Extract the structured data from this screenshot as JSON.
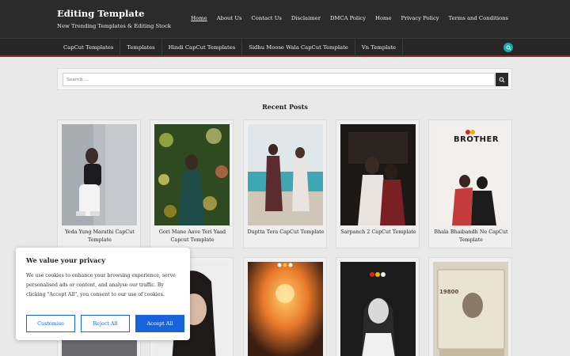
{
  "site": {
    "title": "Editing Template",
    "description": "New Trending Templates & Editing Stock"
  },
  "top_nav": [
    "Home",
    "About Us",
    "Contact Us",
    "Disclaimer",
    "DMCA Policy",
    "Home",
    "Privacy Policy",
    "Terms and Conditions"
  ],
  "secondary_nav": [
    "CapCut Templates",
    "Templates",
    "Hindi CapCut Templates",
    "Sidhu Moose Wala CapCut Template",
    "Vn Template"
  ],
  "search": {
    "placeholder": "Search ..."
  },
  "section_title": "Recent Posts",
  "posts_row1": [
    {
      "title": "Yeda Yung Marathi CapCut Template"
    },
    {
      "title": "Gori Mane Aave Teri Yaad Capcut Template"
    },
    {
      "title": "Duptta Tera CapCut Template"
    },
    {
      "title": "Sarpanch 2 CapCut Template"
    },
    {
      "title": "Bhala Bhaibandh Ne CapCut Template",
      "overlay": "BROTHER"
    }
  ],
  "posts_row2": [
    {
      "title": ""
    },
    {
      "title": ""
    },
    {
      "title": ""
    },
    {
      "title": ""
    },
    {
      "title": "",
      "overlay": "19800"
    }
  ],
  "cookie": {
    "title": "We value your privacy",
    "text": "We use cookies to enhance your browsing experience, serve personalised ads or content, and analyse our traffic. By clicking \"Accept All\", you consent to our use of cookies.",
    "customise": "Customise",
    "reject": "Reject All",
    "accept": "Accept All"
  },
  "colors": {
    "header_bg": "#2b2b2b",
    "accent_search": "#1aa7b0",
    "cookie_blue": "#1863dc",
    "nav_border": "#8a2e2e"
  }
}
